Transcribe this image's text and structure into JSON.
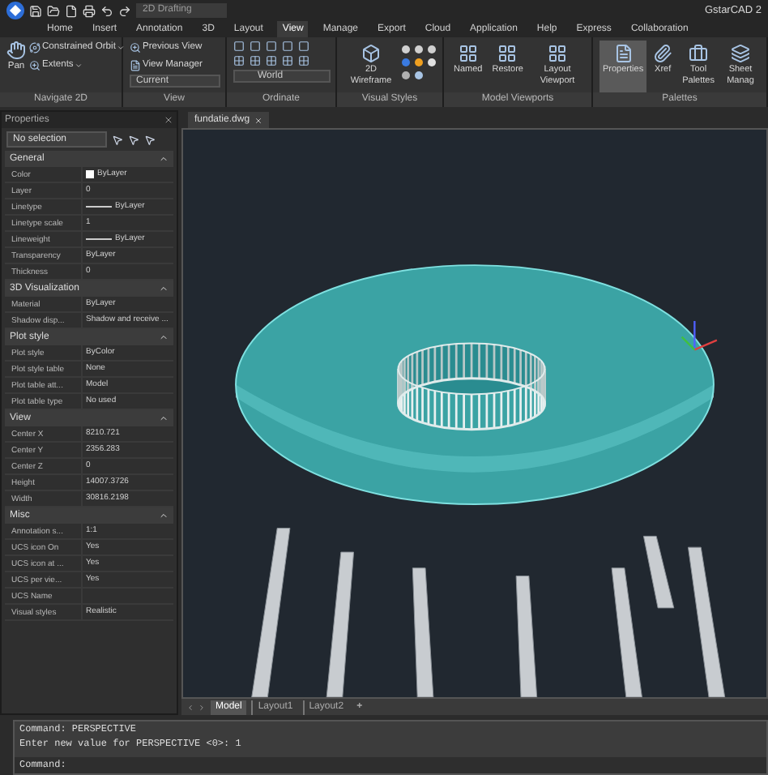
{
  "title_bar": {
    "workspace": "2D Drafting",
    "app_name": "GstarCAD 2"
  },
  "ribbon_tabs": [
    {
      "label": "Home",
      "selected": false
    },
    {
      "label": "Insert",
      "selected": false
    },
    {
      "label": "Annotation",
      "selected": false
    },
    {
      "label": "3D",
      "selected": false
    },
    {
      "label": "Layout",
      "selected": false
    },
    {
      "label": "View",
      "selected": true
    },
    {
      "label": "Manage",
      "selected": false
    },
    {
      "label": "Export",
      "selected": false
    },
    {
      "label": "Cloud",
      "selected": false
    },
    {
      "label": "Application",
      "selected": false
    },
    {
      "label": "Help",
      "selected": false
    },
    {
      "label": "Express",
      "selected": false
    },
    {
      "label": "Collaboration",
      "selected": false
    }
  ],
  "panels": {
    "navigate": {
      "label": "Navigate 2D",
      "pan": "Pan",
      "orbit": "Constrained Orbit",
      "extents": "Extents"
    },
    "view": {
      "label": "View",
      "previous": "Previous View",
      "manager": "View Manager",
      "current": "Current"
    },
    "ordinate": {
      "label": "Ordinate",
      "ucs": "World"
    },
    "visual_styles": {
      "label": "Visual Styles",
      "style": "2D Wireframe"
    },
    "model_viewports": {
      "label": "Model Viewports",
      "buttons": [
        "Named",
        "Restore",
        "Layout Viewport"
      ]
    },
    "palettes": {
      "label": "Palettes",
      "buttons": [
        {
          "label": "Properties",
          "selected": true
        },
        {
          "label": "Xref",
          "selected": false
        },
        {
          "label": "Tool Palettes",
          "selected": false
        },
        {
          "label": "Sheet Manag",
          "selected": false
        }
      ]
    }
  },
  "properties": {
    "title": "Properties",
    "selection": "No selection",
    "sections": [
      {
        "title": "General",
        "expanded": true,
        "rows": [
          {
            "label": "Color",
            "value": "ByLayer",
            "kind": "color"
          },
          {
            "label": "Layer",
            "value": "0",
            "kind": "text"
          },
          {
            "label": "Linetype",
            "value": "ByLayer",
            "kind": "line"
          },
          {
            "label": "Linetype scale",
            "value": "1",
            "kind": "text"
          },
          {
            "label": "Lineweight",
            "value": "ByLayer",
            "kind": "line"
          },
          {
            "label": "Transparency",
            "value": "ByLayer",
            "kind": "text"
          },
          {
            "label": "Thickness",
            "value": "0",
            "kind": "text"
          }
        ]
      },
      {
        "title": "3D Visualization",
        "expanded": true,
        "rows": [
          {
            "label": "Material",
            "value": "ByLayer",
            "kind": "text"
          },
          {
            "label": "Shadow disp...",
            "value": "Shadow and receive ...",
            "kind": "text"
          }
        ]
      },
      {
        "title": "Plot style",
        "expanded": true,
        "rows": [
          {
            "label": "Plot style",
            "value": "ByColor",
            "kind": "text"
          },
          {
            "label": "Plot style table",
            "value": "None",
            "kind": "text"
          },
          {
            "label": "Plot table att...",
            "value": "Model",
            "kind": "text"
          },
          {
            "label": "Plot table type",
            "value": "No used",
            "kind": "text"
          }
        ]
      },
      {
        "title": "View",
        "expanded": true,
        "rows": [
          {
            "label": "Center X",
            "value": "8210.721",
            "kind": "text"
          },
          {
            "label": "Center Y",
            "value": "2356.283",
            "kind": "text"
          },
          {
            "label": "Center Z",
            "value": "0",
            "kind": "text"
          },
          {
            "label": "Height",
            "value": "14007.3726",
            "kind": "text"
          },
          {
            "label": "Width",
            "value": "30816.2198",
            "kind": "text"
          }
        ]
      },
      {
        "title": "Misc",
        "expanded": true,
        "rows": [
          {
            "label": "Annotation s...",
            "value": "1:1",
            "kind": "text"
          },
          {
            "label": "UCS icon On",
            "value": "Yes",
            "kind": "text"
          },
          {
            "label": "UCS icon at ...",
            "value": "Yes",
            "kind": "text"
          },
          {
            "label": "UCS per vie...",
            "value": "Yes",
            "kind": "text"
          },
          {
            "label": "UCS Name",
            "kind": "text"
          },
          {
            "label": "Visual styles",
            "value": "Realistic",
            "kind": "text"
          }
        ]
      }
    ]
  },
  "document_tab": "fundatie.dwg",
  "layout_tabs": [
    {
      "label": "Model",
      "selected": true,
      "kind": "model"
    },
    {
      "label": "Layout1",
      "selected": false,
      "kind": "layout"
    },
    {
      "label": "Layout2",
      "selected": false,
      "kind": "layout"
    },
    {
      "label": "+",
      "selected": false,
      "kind": "add"
    }
  ],
  "command_line": {
    "history": [
      "Command: PERSPECTIVE",
      "Enter new value for PERSPECTIVE <0>: 1"
    ],
    "prompt": "Command:"
  }
}
